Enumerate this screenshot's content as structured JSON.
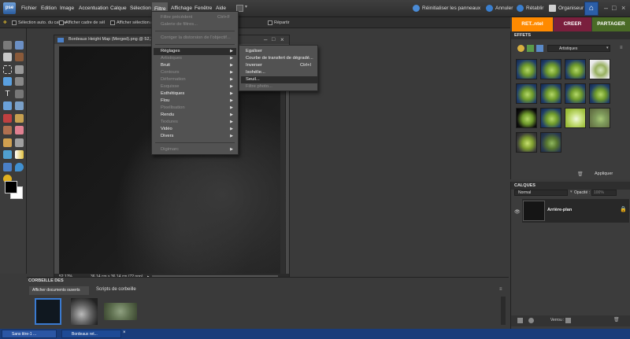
{
  "app": {
    "logo_text": "pse",
    "menus": [
      "Fichier",
      "Edition",
      "Image",
      "Accentuation",
      "Calque",
      "Sélection",
      "Filtre",
      "Affichage",
      "Fenêtre",
      "Aide"
    ],
    "active_menu": "Filtre",
    "right_actions": {
      "reset_panels": "Réinitialiser les panneaux",
      "undo": "Annuler",
      "redo": "Rétablir",
      "organizer": "Organiseur"
    }
  },
  "options_bar": {
    "opt1": "Sélection auto. du calque",
    "opt2": "Afficher cadre de sél",
    "opt3": "Afficher sélection au",
    "opt4": "Répartir"
  },
  "tabs": {
    "edit": "RET..ntel",
    "create": "CREER",
    "share": "PARTAGER"
  },
  "document": {
    "title": "Bordeaux Height Map (Merged).png @ 52,1% (G",
    "zoom": "52,17%",
    "size_info": "36,14 cm x 36,14 cm (72 ppp)"
  },
  "filtre_menu": {
    "items": [
      {
        "label": "Filtre précédent",
        "shortcut": "Ctrl+F"
      },
      {
        "label": "Galerie de filtres..."
      },
      {
        "label": "Corriger la distorsion de l'objectif..."
      },
      {
        "label": "Réglages"
      },
      {
        "label": "Artistiques"
      },
      {
        "label": "Bruit"
      },
      {
        "label": "Contours"
      },
      {
        "label": "Déformation"
      },
      {
        "label": "Esquisse"
      },
      {
        "label": "Esthétiques"
      },
      {
        "label": "Flou"
      },
      {
        "label": "Pixellisation"
      },
      {
        "label": "Rendu"
      },
      {
        "label": "Textures"
      },
      {
        "label": "Vidéo"
      },
      {
        "label": "Divers"
      },
      {
        "label": "Digimarc"
      }
    ]
  },
  "reglages_menu": {
    "items": [
      {
        "label": "Egaliser"
      },
      {
        "label": "Courbe de transfert de dégradé..."
      },
      {
        "label": "Inverser",
        "shortcut": "Ctrl+I"
      },
      {
        "label": "Isohélie..."
      },
      {
        "label": "Seuil..."
      },
      {
        "label": "Filtre photo..."
      }
    ]
  },
  "effects": {
    "header": "EFFETS",
    "category": "Artistiques",
    "apply": "Appliquer"
  },
  "layers": {
    "header": "CALQUES",
    "blend_mode": "Normal",
    "opacity_label": "Opacité :",
    "opacity_value": "100%",
    "layer_name": "Arrière-plan",
    "lock_label": "Verrou :"
  },
  "bin": {
    "header": "CORBEILLE DES",
    "show_open": "Afficher documents ouverts",
    "scripts": "Scripts de corbeille"
  },
  "taskbar": {
    "task1": "Sans titre-1 ...",
    "task2": "Bordeaux ret..."
  }
}
